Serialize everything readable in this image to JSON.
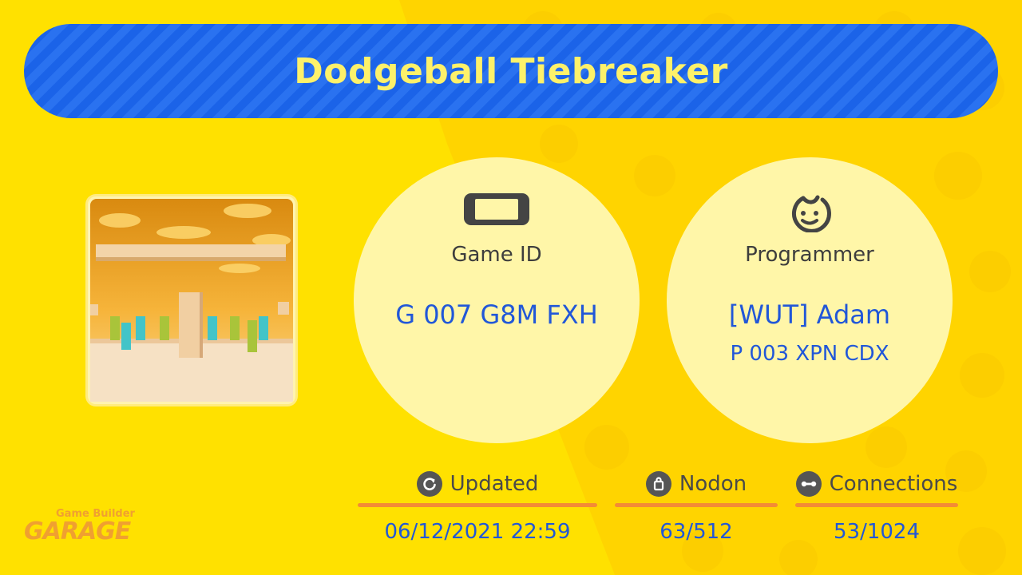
{
  "title": "Dodgeball Tiebreaker",
  "game_id": {
    "icon": "switch-console-icon",
    "label": "Game ID",
    "value": "G 007 G8M FXH"
  },
  "programmer": {
    "icon": "face-icon",
    "label": "Programmer",
    "name": "[WUT] Adam",
    "id": "P 003 XPN CDX"
  },
  "stats": {
    "updated": {
      "icon": "refresh-icon",
      "label": "Updated",
      "value": "06/12/2021 22:59"
    },
    "nodon": {
      "icon": "bag-icon",
      "label": "Nodon",
      "value": "63/512"
    },
    "connections": {
      "icon": "link-icon",
      "label": "Connections",
      "value": "53/1024"
    }
  },
  "logo": {
    "small": "Game Builder",
    "big": "GARAGE"
  },
  "colors": {
    "background": "#ffe100",
    "title_bar": "#1b63e8",
    "title_text": "#fdf16a",
    "value_text": "#2157d8",
    "accent_line": "#f48b35",
    "circle_fill": "#fff6a8"
  }
}
